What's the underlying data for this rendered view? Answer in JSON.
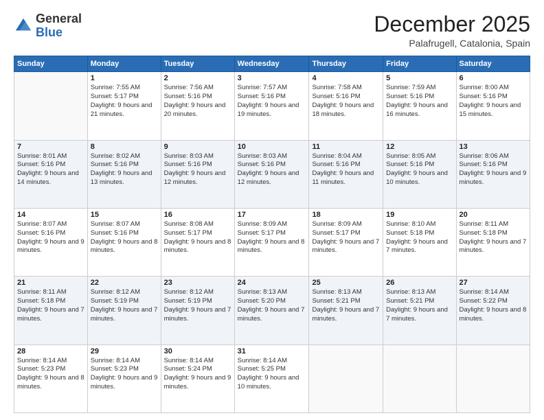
{
  "logo": {
    "general": "General",
    "blue": "Blue"
  },
  "header": {
    "month": "December 2025",
    "location": "Palafrugell, Catalonia, Spain"
  },
  "days_of_week": [
    "Sunday",
    "Monday",
    "Tuesday",
    "Wednesday",
    "Thursday",
    "Friday",
    "Saturday"
  ],
  "weeks": [
    [
      {
        "day": "",
        "sunrise": "",
        "sunset": "",
        "daylight": ""
      },
      {
        "day": "1",
        "sunrise": "Sunrise: 7:55 AM",
        "sunset": "Sunset: 5:17 PM",
        "daylight": "Daylight: 9 hours and 21 minutes."
      },
      {
        "day": "2",
        "sunrise": "Sunrise: 7:56 AM",
        "sunset": "Sunset: 5:16 PM",
        "daylight": "Daylight: 9 hours and 20 minutes."
      },
      {
        "day": "3",
        "sunrise": "Sunrise: 7:57 AM",
        "sunset": "Sunset: 5:16 PM",
        "daylight": "Daylight: 9 hours and 19 minutes."
      },
      {
        "day": "4",
        "sunrise": "Sunrise: 7:58 AM",
        "sunset": "Sunset: 5:16 PM",
        "daylight": "Daylight: 9 hours and 18 minutes."
      },
      {
        "day": "5",
        "sunrise": "Sunrise: 7:59 AM",
        "sunset": "Sunset: 5:16 PM",
        "daylight": "Daylight: 9 hours and 16 minutes."
      },
      {
        "day": "6",
        "sunrise": "Sunrise: 8:00 AM",
        "sunset": "Sunset: 5:16 PM",
        "daylight": "Daylight: 9 hours and 15 minutes."
      }
    ],
    [
      {
        "day": "7",
        "sunrise": "Sunrise: 8:01 AM",
        "sunset": "Sunset: 5:16 PM",
        "daylight": "Daylight: 9 hours and 14 minutes."
      },
      {
        "day": "8",
        "sunrise": "Sunrise: 8:02 AM",
        "sunset": "Sunset: 5:16 PM",
        "daylight": "Daylight: 9 hours and 13 minutes."
      },
      {
        "day": "9",
        "sunrise": "Sunrise: 8:03 AM",
        "sunset": "Sunset: 5:16 PM",
        "daylight": "Daylight: 9 hours and 12 minutes."
      },
      {
        "day": "10",
        "sunrise": "Sunrise: 8:03 AM",
        "sunset": "Sunset: 5:16 PM",
        "daylight": "Daylight: 9 hours and 12 minutes."
      },
      {
        "day": "11",
        "sunrise": "Sunrise: 8:04 AM",
        "sunset": "Sunset: 5:16 PM",
        "daylight": "Daylight: 9 hours and 11 minutes."
      },
      {
        "day": "12",
        "sunrise": "Sunrise: 8:05 AM",
        "sunset": "Sunset: 5:16 PM",
        "daylight": "Daylight: 9 hours and 10 minutes."
      },
      {
        "day": "13",
        "sunrise": "Sunrise: 8:06 AM",
        "sunset": "Sunset: 5:16 PM",
        "daylight": "Daylight: 9 hours and 9 minutes."
      }
    ],
    [
      {
        "day": "14",
        "sunrise": "Sunrise: 8:07 AM",
        "sunset": "Sunset: 5:16 PM",
        "daylight": "Daylight: 9 hours and 9 minutes."
      },
      {
        "day": "15",
        "sunrise": "Sunrise: 8:07 AM",
        "sunset": "Sunset: 5:16 PM",
        "daylight": "Daylight: 9 hours and 8 minutes."
      },
      {
        "day": "16",
        "sunrise": "Sunrise: 8:08 AM",
        "sunset": "Sunset: 5:17 PM",
        "daylight": "Daylight: 9 hours and 8 minutes."
      },
      {
        "day": "17",
        "sunrise": "Sunrise: 8:09 AM",
        "sunset": "Sunset: 5:17 PM",
        "daylight": "Daylight: 9 hours and 8 minutes."
      },
      {
        "day": "18",
        "sunrise": "Sunrise: 8:09 AM",
        "sunset": "Sunset: 5:17 PM",
        "daylight": "Daylight: 9 hours and 7 minutes."
      },
      {
        "day": "19",
        "sunrise": "Sunrise: 8:10 AM",
        "sunset": "Sunset: 5:18 PM",
        "daylight": "Daylight: 9 hours and 7 minutes."
      },
      {
        "day": "20",
        "sunrise": "Sunrise: 8:11 AM",
        "sunset": "Sunset: 5:18 PM",
        "daylight": "Daylight: 9 hours and 7 minutes."
      }
    ],
    [
      {
        "day": "21",
        "sunrise": "Sunrise: 8:11 AM",
        "sunset": "Sunset: 5:18 PM",
        "daylight": "Daylight: 9 hours and 7 minutes."
      },
      {
        "day": "22",
        "sunrise": "Sunrise: 8:12 AM",
        "sunset": "Sunset: 5:19 PM",
        "daylight": "Daylight: 9 hours and 7 minutes."
      },
      {
        "day": "23",
        "sunrise": "Sunrise: 8:12 AM",
        "sunset": "Sunset: 5:19 PM",
        "daylight": "Daylight: 9 hours and 7 minutes."
      },
      {
        "day": "24",
        "sunrise": "Sunrise: 8:13 AM",
        "sunset": "Sunset: 5:20 PM",
        "daylight": "Daylight: 9 hours and 7 minutes."
      },
      {
        "day": "25",
        "sunrise": "Sunrise: 8:13 AM",
        "sunset": "Sunset: 5:21 PM",
        "daylight": "Daylight: 9 hours and 7 minutes."
      },
      {
        "day": "26",
        "sunrise": "Sunrise: 8:13 AM",
        "sunset": "Sunset: 5:21 PM",
        "daylight": "Daylight: 9 hours and 7 minutes."
      },
      {
        "day": "27",
        "sunrise": "Sunrise: 8:14 AM",
        "sunset": "Sunset: 5:22 PM",
        "daylight": "Daylight: 9 hours and 8 minutes."
      }
    ],
    [
      {
        "day": "28",
        "sunrise": "Sunrise: 8:14 AM",
        "sunset": "Sunset: 5:23 PM",
        "daylight": "Daylight: 9 hours and 8 minutes."
      },
      {
        "day": "29",
        "sunrise": "Sunrise: 8:14 AM",
        "sunset": "Sunset: 5:23 PM",
        "daylight": "Daylight: 9 hours and 9 minutes."
      },
      {
        "day": "30",
        "sunrise": "Sunrise: 8:14 AM",
        "sunset": "Sunset: 5:24 PM",
        "daylight": "Daylight: 9 hours and 9 minutes."
      },
      {
        "day": "31",
        "sunrise": "Sunrise: 8:14 AM",
        "sunset": "Sunset: 5:25 PM",
        "daylight": "Daylight: 9 hours and 10 minutes."
      },
      {
        "day": "",
        "sunrise": "",
        "sunset": "",
        "daylight": ""
      },
      {
        "day": "",
        "sunrise": "",
        "sunset": "",
        "daylight": ""
      },
      {
        "day": "",
        "sunrise": "",
        "sunset": "",
        "daylight": ""
      }
    ]
  ]
}
